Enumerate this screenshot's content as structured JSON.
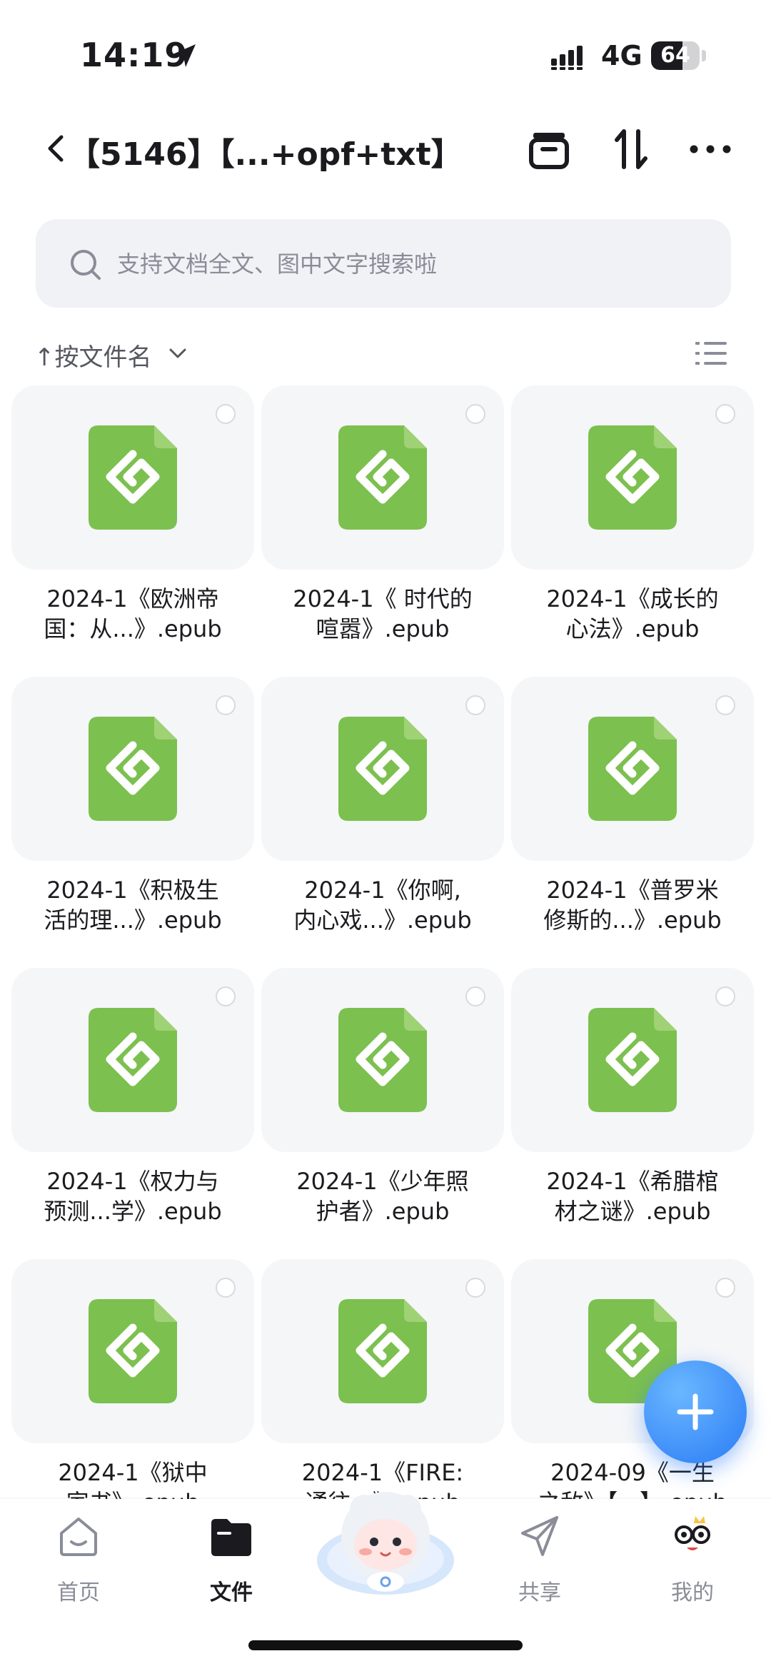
{
  "status_bar": {
    "time": "14:19",
    "network": "4G",
    "battery": "64",
    "battery_level": 0.64
  },
  "header": {
    "title": "【5146】【...+opf+txt】"
  },
  "search": {
    "placeholder": "支持文档全文、图中文字搜索啦"
  },
  "sort": {
    "label": "↑按文件名"
  },
  "files": [
    {
      "line1": "2024-1《欧洲帝",
      "line2": "国：从...》.epub"
    },
    {
      "line1": "2024-1《 时代的",
      "line2": "喧嚣》.epub"
    },
    {
      "line1": "2024-1《成长的",
      "line2": "心法》.epub"
    },
    {
      "line1": "2024-1《积极生",
      "line2": "活的理...》.epub"
    },
    {
      "line1": "2024-1《你啊,",
      "line2": "内心戏...》.epub"
    },
    {
      "line1": "2024-1《普罗米",
      "line2": "修斯的...》.epub"
    },
    {
      "line1": "2024-1《权力与",
      "line2": "预测...学》.epub"
    },
    {
      "line1": "2024-1《少年照",
      "line2": "护者》.epub"
    },
    {
      "line1": "2024-1《希腊棺",
      "line2": "材之谜》.epub"
    },
    {
      "line1": "2024-1《狱中",
      "line2": "家书》.epub"
    },
    {
      "line1": "2024-1《FIRE:",
      "line2": "通往...》.epub"
    },
    {
      "line1": "2024-09《一生",
      "line2": "之敌》【...】.epub"
    }
  ],
  "tabbar": {
    "home": "首页",
    "files": "文件",
    "share": "共享",
    "mine": "我的"
  },
  "colors": {
    "epub_green": "#7cc04f",
    "accent_blue": "#2a7bf6",
    "card_bg": "#f5f6f8"
  }
}
